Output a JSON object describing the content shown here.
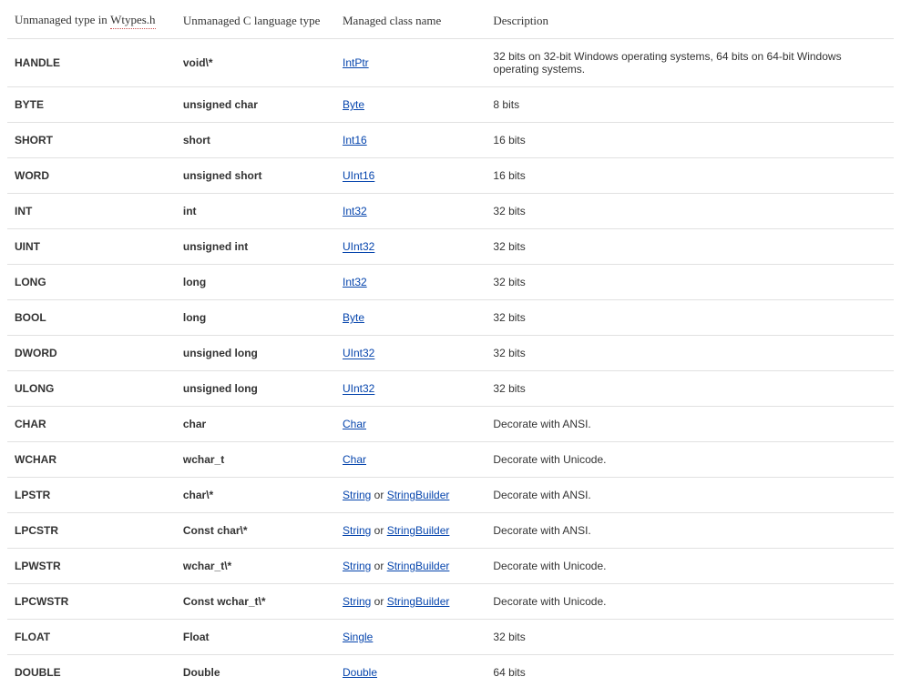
{
  "headers": {
    "col1_prefix": "Unmanaged type in ",
    "col1_wtypes": "Wtypes.h",
    "col2": "Unmanaged C language type",
    "col3": "Managed class name",
    "col4": "Description"
  },
  "or_text": " or ",
  "rows": [
    {
      "unmanaged_type": "HANDLE",
      "c_type": "void\\*",
      "managed": [
        {
          "text": "IntPtr",
          "href": true,
          "wavy": false
        }
      ],
      "description": "32 bits on 32-bit Windows operating systems, 64 bits on 64-bit Windows operating systems."
    },
    {
      "unmanaged_type": "BYTE",
      "c_type": "unsigned char",
      "managed": [
        {
          "text": "Byte",
          "href": true,
          "wavy": false
        }
      ],
      "description": "8 bits"
    },
    {
      "unmanaged_type": "SHORT",
      "c_type": "short",
      "managed": [
        {
          "text": "Int16",
          "href": true,
          "wavy": false
        }
      ],
      "description": "16 bits"
    },
    {
      "unmanaged_type": "WORD",
      "c_type": "unsigned short",
      "managed": [
        {
          "text": "UInt16",
          "href": true,
          "wavy": true
        }
      ],
      "description": "16 bits"
    },
    {
      "unmanaged_type": "INT",
      "c_type": "int",
      "managed": [
        {
          "text": "Int32",
          "href": true,
          "wavy": false
        }
      ],
      "description": "32 bits"
    },
    {
      "unmanaged_type": "UINT",
      "c_type": "unsigned int",
      "managed": [
        {
          "text": "UInt32",
          "href": true,
          "wavy": true
        }
      ],
      "description": "32 bits"
    },
    {
      "unmanaged_type": "LONG",
      "c_type": "long",
      "managed": [
        {
          "text": "Int32",
          "href": true,
          "wavy": false
        }
      ],
      "description": "32 bits"
    },
    {
      "unmanaged_type": "BOOL",
      "c_type": "long",
      "managed": [
        {
          "text": "Byte",
          "href": true,
          "wavy": false
        }
      ],
      "description": "32 bits"
    },
    {
      "unmanaged_type": "DWORD",
      "c_type": "unsigned long",
      "managed": [
        {
          "text": "UInt32",
          "href": true,
          "wavy": true
        }
      ],
      "description": "32 bits"
    },
    {
      "unmanaged_type": "ULONG",
      "c_type": "unsigned long",
      "managed": [
        {
          "text": "UInt32",
          "href": true,
          "wavy": true
        }
      ],
      "description": "32 bits"
    },
    {
      "unmanaged_type": "CHAR",
      "c_type": "char",
      "managed": [
        {
          "text": "Char",
          "href": true,
          "wavy": false
        }
      ],
      "description": "Decorate with ANSI."
    },
    {
      "unmanaged_type": "WCHAR",
      "c_type": "wchar_t",
      "managed": [
        {
          "text": "Char",
          "href": true,
          "wavy": false
        }
      ],
      "description": "Decorate with Unicode."
    },
    {
      "unmanaged_type": "LPSTR",
      "c_type": "char\\*",
      "managed": [
        {
          "text": "String",
          "href": true,
          "wavy": false
        },
        {
          "text": "StringBuilder",
          "href": true,
          "wavy": false
        }
      ],
      "description": "Decorate with ANSI."
    },
    {
      "unmanaged_type": "LPCSTR",
      "c_type": "Const char\\*",
      "managed": [
        {
          "text": "String",
          "href": true,
          "wavy": false
        },
        {
          "text": "StringBuilder",
          "href": true,
          "wavy": false
        }
      ],
      "description": "Decorate with ANSI."
    },
    {
      "unmanaged_type": "LPWSTR",
      "c_type": "wchar_t\\*",
      "managed": [
        {
          "text": "String",
          "href": true,
          "wavy": false
        },
        {
          "text": "StringBuilder",
          "href": true,
          "wavy": false
        }
      ],
      "description": "Decorate with Unicode."
    },
    {
      "unmanaged_type": "LPCWSTR",
      "c_type": "Const wchar_t\\*",
      "managed": [
        {
          "text": "String",
          "href": true,
          "wavy": false
        },
        {
          "text": "StringBuilder",
          "href": true,
          "wavy": false
        }
      ],
      "description": "Decorate with Unicode."
    },
    {
      "unmanaged_type": "FLOAT",
      "c_type": "Float",
      "managed": [
        {
          "text": "Single",
          "href": true,
          "wavy": false
        }
      ],
      "description": "32 bits"
    },
    {
      "unmanaged_type": "DOUBLE",
      "c_type": "Double",
      "managed": [
        {
          "text": "Double",
          "href": true,
          "wavy": false
        }
      ],
      "description": "64 bits"
    }
  ]
}
